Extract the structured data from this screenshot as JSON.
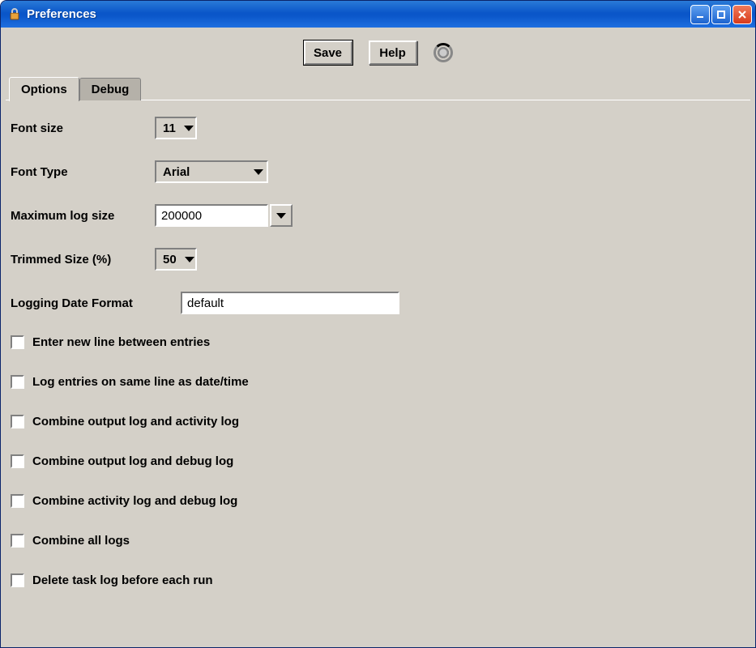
{
  "window": {
    "title": "Preferences"
  },
  "toolbar": {
    "save_label": "Save",
    "help_label": "Help"
  },
  "tabs": {
    "options": "Options",
    "debug": "Debug",
    "active": "options"
  },
  "options": {
    "font_size": {
      "label": "Font size",
      "value": "11"
    },
    "font_type": {
      "label": "Font Type",
      "value": "Arial"
    },
    "max_log_size": {
      "label": "Maximum log size",
      "value": "200000"
    },
    "trimmed_size": {
      "label": "Trimmed Size (%)",
      "value": "50"
    },
    "date_format": {
      "label": "Logging Date Format",
      "value": "default"
    },
    "checkboxes": [
      {
        "label": "Enter new line between entries",
        "checked": false
      },
      {
        "label": "Log entries on same line as date/time",
        "checked": false
      },
      {
        "label": "Combine output log and activity log",
        "checked": false
      },
      {
        "label": "Combine output log and debug log",
        "checked": false
      },
      {
        "label": "Combine activity log and debug log",
        "checked": false
      },
      {
        "label": "Combine all logs",
        "checked": false
      },
      {
        "label": "Delete task log before each run",
        "checked": false
      }
    ]
  }
}
